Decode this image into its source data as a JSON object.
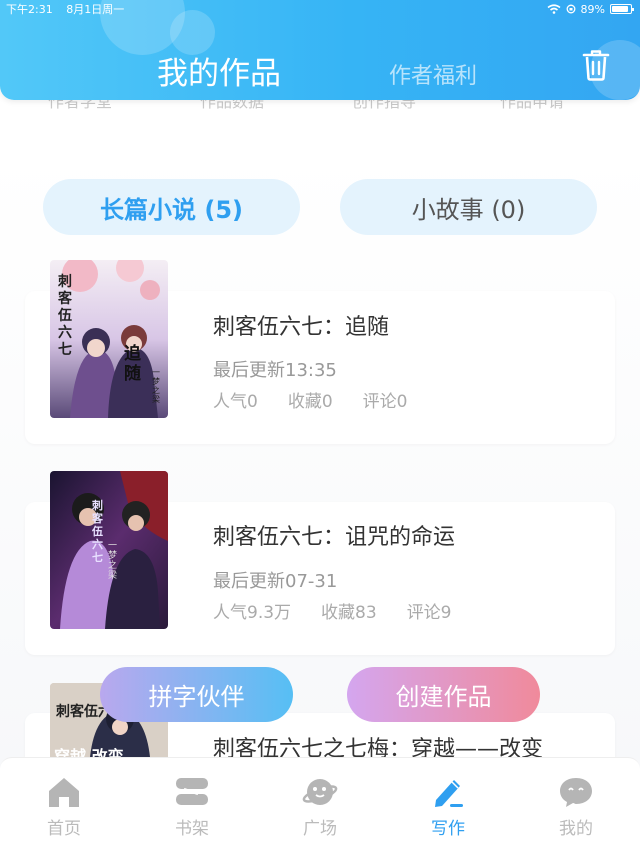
{
  "status_bar": {
    "time": "下午2:31",
    "date": "8月1日周一",
    "battery": "89%",
    "battery_level": 0.89
  },
  "header": {
    "title": "我的作品",
    "secondary_tab": "作者福利",
    "delete_icon": "trash-icon"
  },
  "sub_menu_ghost": [
    "作者学堂",
    "作品数据",
    "创作指导",
    "作品申请"
  ],
  "tabs": [
    {
      "label": "长篇小说 (5)",
      "active": true
    },
    {
      "label": "小故事 (0)",
      "active": false
    }
  ],
  "works": [
    {
      "title": "刺客伍六七：追随",
      "updated": "最后更新13:35",
      "popularity": "人气0",
      "favorites": "收藏0",
      "comments": "评论0",
      "cover_text": "刺客伍六七",
      "cover_title": "追随",
      "cover_author": "一梦之梁"
    },
    {
      "title": "刺客伍六七：诅咒的命运",
      "updated": "最后更新07-31",
      "popularity": "人气9.3万",
      "favorites": "收藏83",
      "comments": "评论9",
      "cover_text": "刺客伍六七",
      "cover_author": "一梦之梁"
    },
    {
      "title": "刺客伍六七之七梅：穿越——改变",
      "cover_text": "刺客伍六",
      "cover_title": "穿越 改变"
    }
  ],
  "actions": {
    "partner": "拼字伙伴",
    "create": "创建作品"
  },
  "bottom_nav": [
    {
      "label": "首页",
      "icon": "home-icon"
    },
    {
      "label": "书架",
      "icon": "bookshelf-icon"
    },
    {
      "label": "广场",
      "icon": "planet-icon"
    },
    {
      "label": "写作",
      "icon": "pen-icon",
      "active": true
    },
    {
      "label": "我的",
      "icon": "chat-bubble-icon"
    }
  ],
  "colors": {
    "accent": "#2f9ff0",
    "header": "#36b4f5",
    "tab_bg": "#e4f3fd",
    "inactive_nav": "#bbbbbb"
  }
}
